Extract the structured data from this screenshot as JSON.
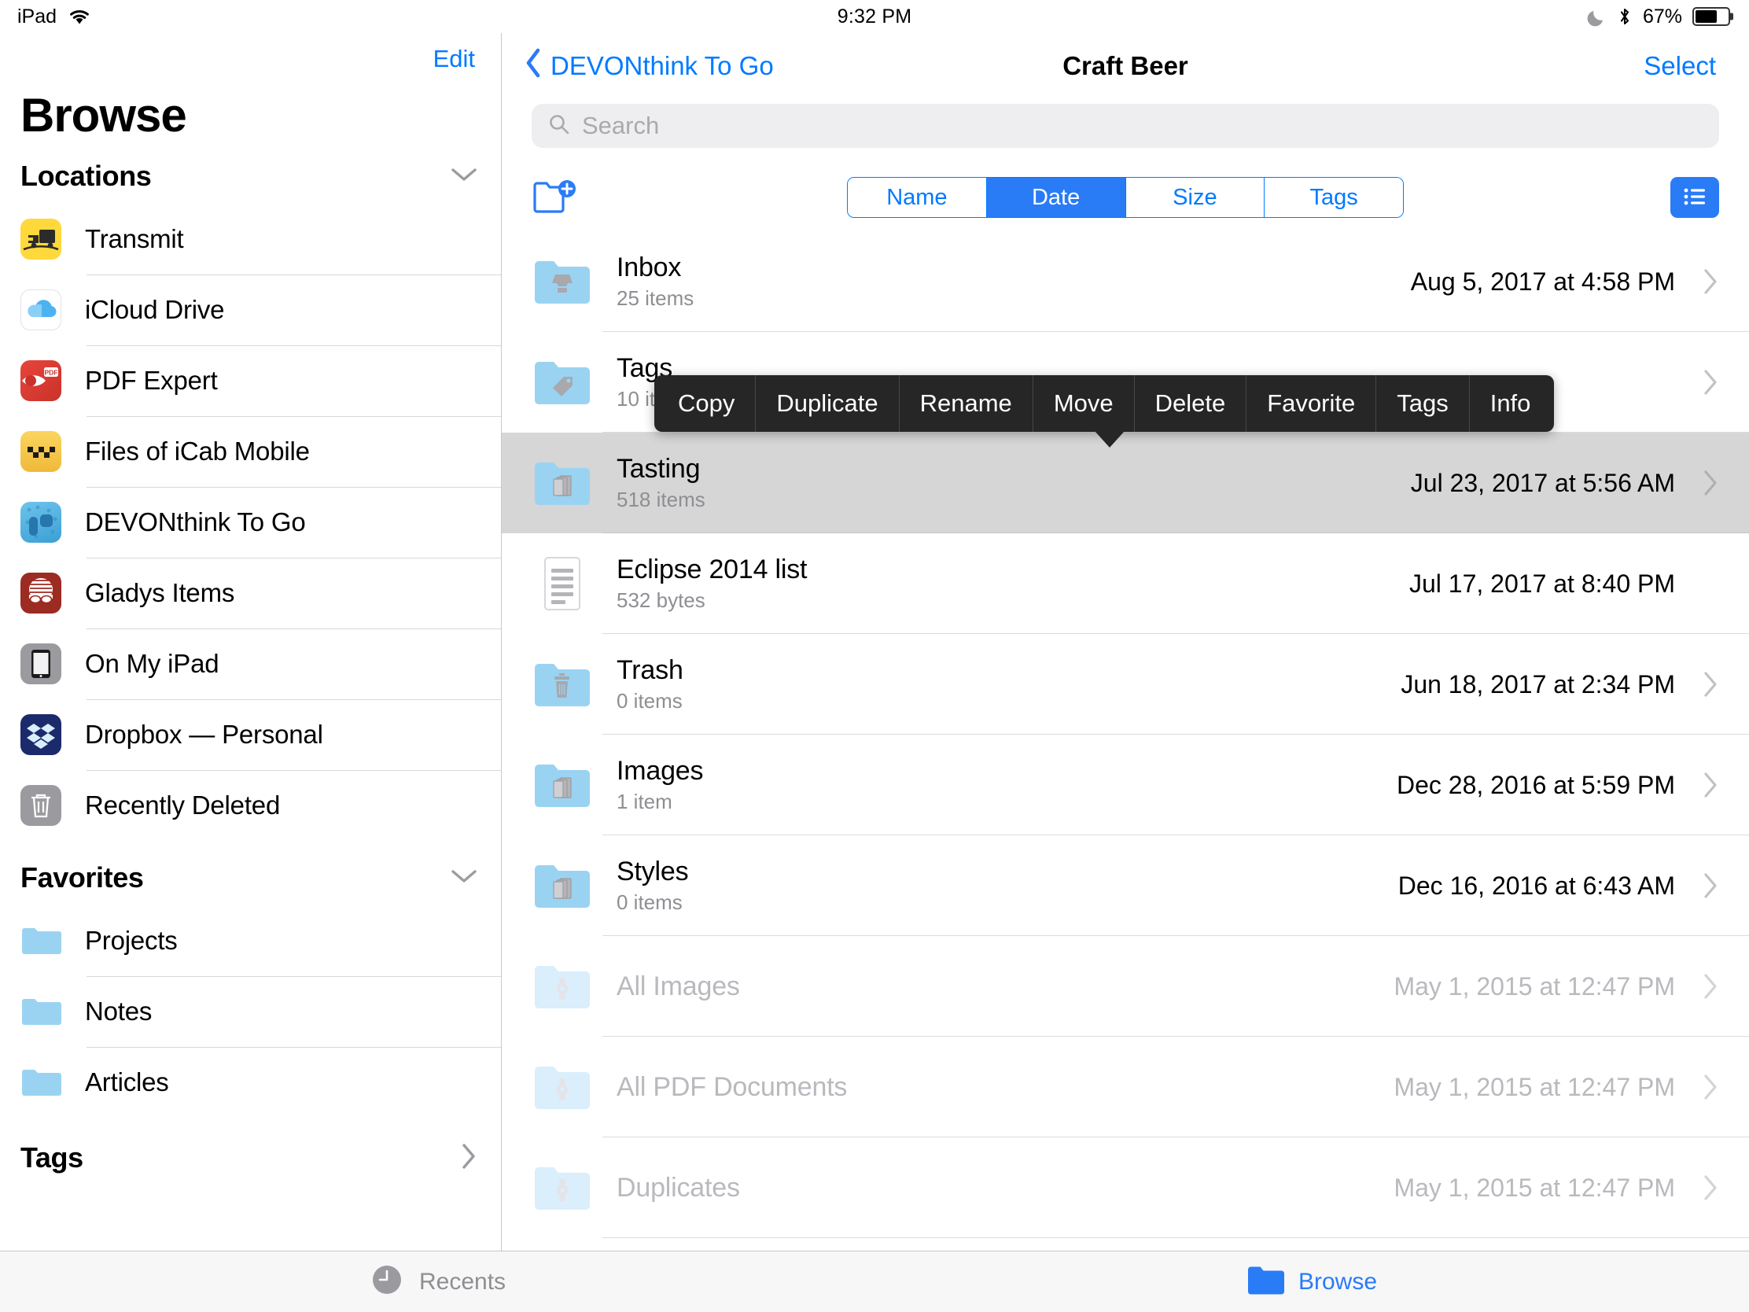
{
  "status_bar": {
    "device": "iPad",
    "wifi_icon": "wifi-icon",
    "time": "9:32 PM",
    "dnd_icon": "moon-icon",
    "bluetooth_icon": "bluetooth-icon",
    "battery_percent": "67%",
    "battery_level": 67
  },
  "sidebar": {
    "edit_label": "Edit",
    "title": "Browse",
    "sections": [
      {
        "name": "Locations",
        "header": "Locations",
        "chevron": "chevron-down-icon",
        "items": [
          {
            "label": "Transmit",
            "icon": "transmit-app-icon"
          },
          {
            "label": "iCloud Drive",
            "icon": "icloud-drive-icon"
          },
          {
            "label": "PDF Expert",
            "icon": "pdf-expert-app-icon"
          },
          {
            "label": "Files of iCab Mobile",
            "icon": "icab-mobile-app-icon"
          },
          {
            "label": "DEVONthink To Go",
            "icon": "devonthink-app-icon"
          },
          {
            "label": "Gladys Items",
            "icon": "gladys-app-icon"
          },
          {
            "label": "On My iPad",
            "icon": "ipad-icon"
          },
          {
            "label": "Dropbox — Personal",
            "icon": "dropbox-app-icon"
          },
          {
            "label": "Recently Deleted",
            "icon": "trash-icon"
          }
        ]
      },
      {
        "name": "Favorites",
        "header": "Favorites",
        "chevron": "chevron-down-icon",
        "items": [
          {
            "label": "Projects",
            "icon": "folder-icon"
          },
          {
            "label": "Notes",
            "icon": "folder-icon"
          },
          {
            "label": "Articles",
            "icon": "folder-icon"
          }
        ]
      },
      {
        "name": "Tags",
        "header": "Tags",
        "chevron": "chevron-right-icon",
        "items": []
      }
    ]
  },
  "detail": {
    "back_label": "DEVONthink To Go",
    "back_icon": "chevron-left-icon",
    "title": "Craft Beer",
    "select_label": "Select",
    "search": {
      "placeholder": "Search",
      "value": "",
      "icon": "search-icon"
    },
    "toolbar": {
      "new_folder_icon": "new-folder-icon",
      "list_view_icon": "list-view-icon",
      "sort_options": [
        "Name",
        "Date",
        "Size",
        "Tags"
      ],
      "sort_selected": "Date"
    },
    "rows": [
      {
        "name": "Inbox",
        "sub": "25 items",
        "date": "Aug 5, 2017 at 4:58 PM",
        "icon": "folder-inbox-icon",
        "chevron": true,
        "state": "normal"
      },
      {
        "name": "Tags",
        "sub": "10 items",
        "date": "",
        "icon": "folder-tag-icon",
        "chevron": true,
        "state": "normal"
      },
      {
        "name": "Tasting",
        "sub": "518 items",
        "date": "Jul 23, 2017 at 5:56 AM",
        "icon": "folder-docs-icon",
        "chevron": true,
        "state": "selected"
      },
      {
        "name": "Eclipse 2014 list",
        "sub": "532 bytes",
        "date": "Jul 17, 2017 at 8:40 PM",
        "icon": "text-document-icon",
        "chevron": false,
        "state": "normal"
      },
      {
        "name": "Trash",
        "sub": "0 items",
        "date": "Jun 18, 2017 at 2:34 PM",
        "icon": "folder-trash-icon",
        "chevron": true,
        "state": "normal"
      },
      {
        "name": "Images",
        "sub": "1 item",
        "date": "Dec 28, 2016 at 5:59 PM",
        "icon": "folder-docs-icon",
        "chevron": true,
        "state": "normal"
      },
      {
        "name": "Styles",
        "sub": "0 items",
        "date": "Dec 16, 2016 at 6:43 AM",
        "icon": "folder-docs-icon",
        "chevron": true,
        "state": "normal"
      },
      {
        "name": "All Images",
        "sub": "",
        "date": "May 1, 2015 at 12:47 PM",
        "icon": "folder-smartgroup-icon",
        "chevron": true,
        "state": "dimmed"
      },
      {
        "name": "All PDF Documents",
        "sub": "",
        "date": "May 1, 2015 at 12:47 PM",
        "icon": "folder-smartgroup-icon",
        "chevron": true,
        "state": "dimmed"
      },
      {
        "name": "Duplicates",
        "sub": "",
        "date": "May 1, 2015 at 12:47 PM",
        "icon": "folder-smartgroup-icon",
        "chevron": true,
        "state": "dimmed"
      }
    ],
    "context_menu": {
      "items": [
        "Copy",
        "Duplicate",
        "Rename",
        "Move",
        "Delete",
        "Favorite",
        "Tags",
        "Info"
      ],
      "pointer_target": "Move"
    }
  },
  "tab_bar": {
    "tabs": [
      {
        "label": "Recents",
        "icon": "clock-icon",
        "active": false
      },
      {
        "label": "Browse",
        "icon": "folder-icon",
        "active": true
      }
    ]
  },
  "colors": {
    "accent_blue": "#007aff",
    "segment_blue": "#2a7bf6",
    "folder_blue": "#9ad3f2",
    "menu_dark": "#262626",
    "selected_gray": "#d6d6d6",
    "subtitle_gray": "#8e8e93"
  }
}
